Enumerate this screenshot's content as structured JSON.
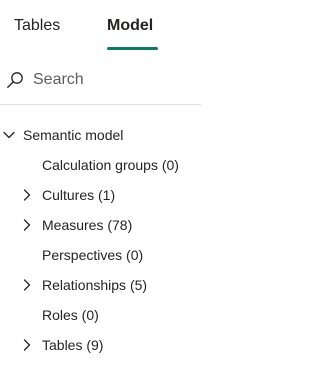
{
  "tabs": {
    "tables_label": "Tables",
    "model_label": "Model",
    "active_tab": "Model"
  },
  "search": {
    "placeholder": "Search",
    "value": ""
  },
  "tree": {
    "root_label": "Semantic model",
    "root_expanded": true,
    "items": [
      {
        "label": "Calculation groups (0)",
        "expandable": false
      },
      {
        "label": "Cultures (1)",
        "expandable": true
      },
      {
        "label": "Measures (78)",
        "expandable": true
      },
      {
        "label": "Perspectives (0)",
        "expandable": false
      },
      {
        "label": "Relationships (5)",
        "expandable": true
      },
      {
        "label": "Roles (0)",
        "expandable": false
      },
      {
        "label": "Tables (9)",
        "expandable": true
      }
    ]
  },
  "icons": {
    "search": "search-icon",
    "expanded": "chevron-down-icon",
    "collapsed": "chevron-right-icon"
  },
  "colors": {
    "accent": "#117865",
    "text": "#252423",
    "divider": "#e1dfdd"
  }
}
